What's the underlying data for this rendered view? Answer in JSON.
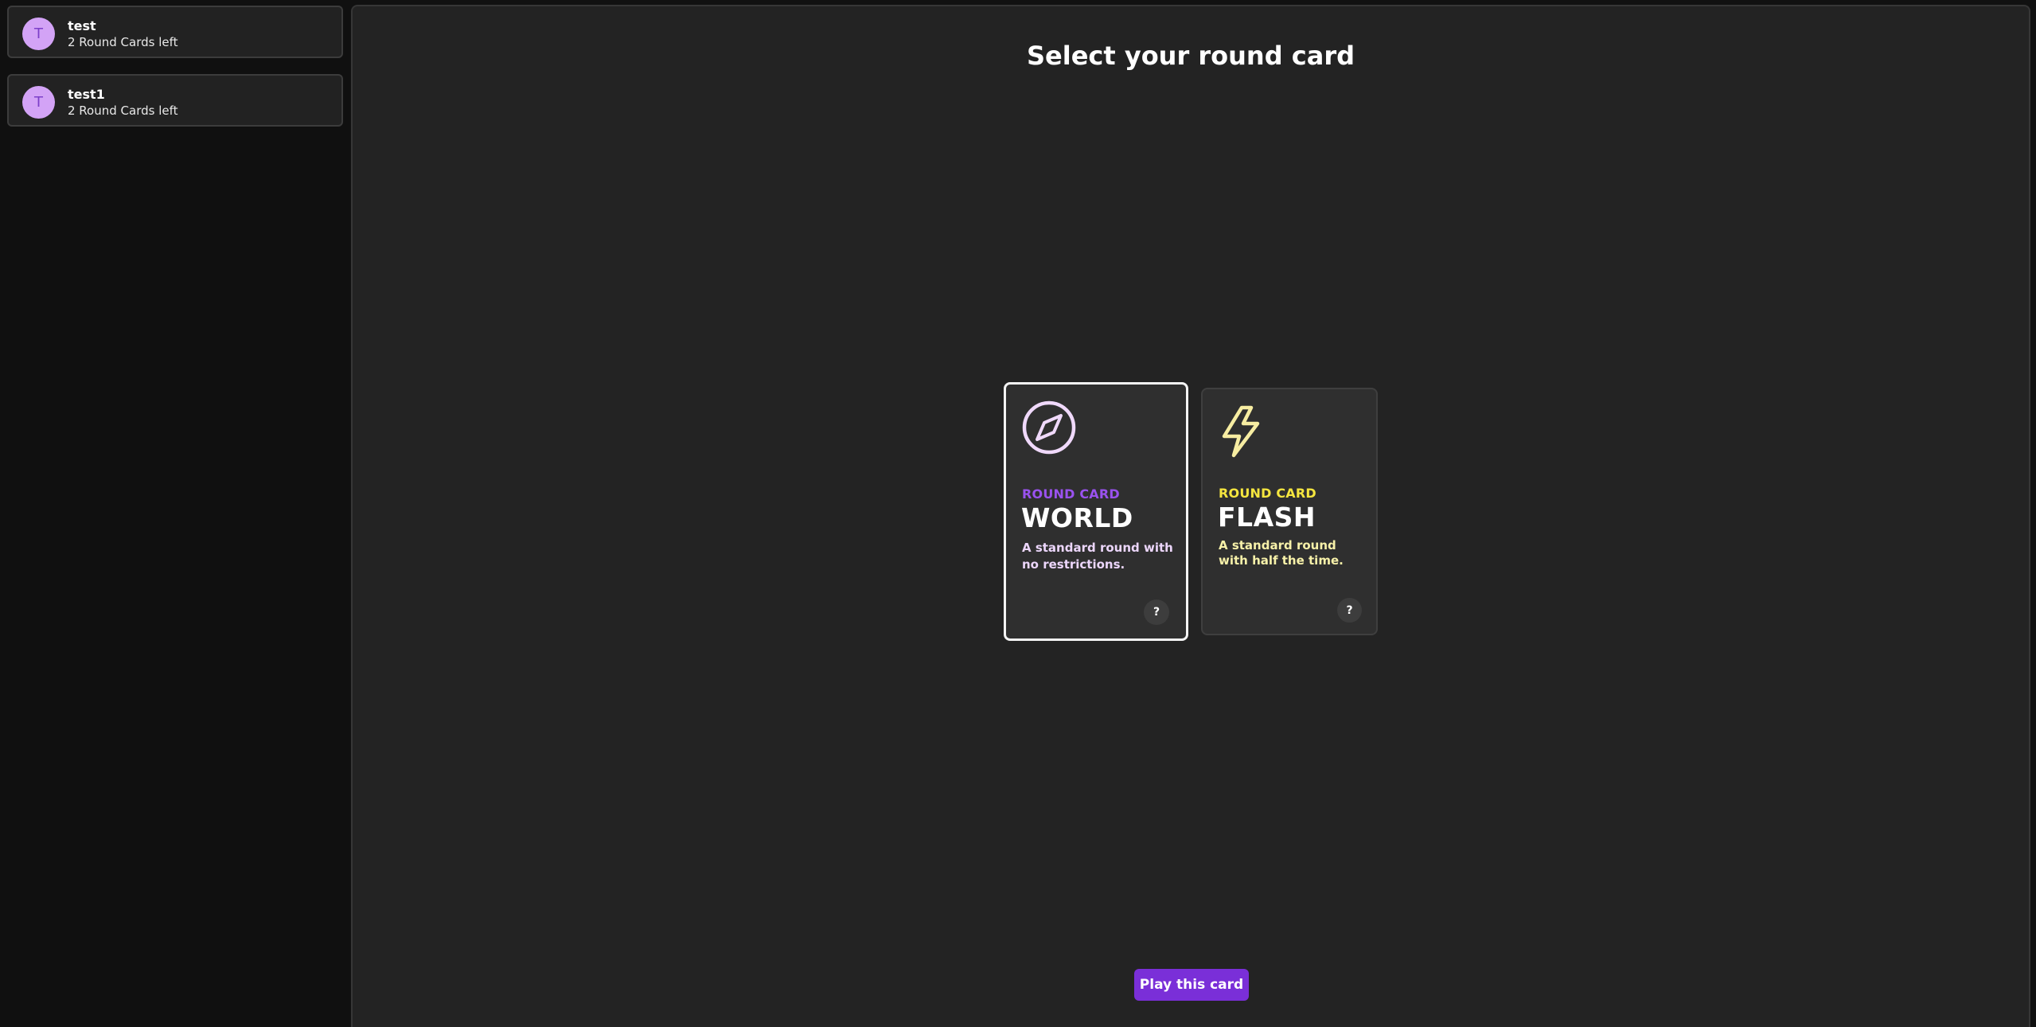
{
  "players": [
    {
      "initial": "T",
      "name": "test",
      "status": "2 Round Cards left"
    },
    {
      "initial": "T",
      "name": "test1",
      "status": "2 Round Cards left"
    }
  ],
  "main": {
    "title": "Select your round card",
    "play_button_label": "Play this card"
  },
  "cards": [
    {
      "kicker": "ROUND CARD",
      "title": "WORLD",
      "description": "A standard round with no restrictions.",
      "help_label": "?",
      "icon": "compass-icon",
      "accent_color": "#9a52ef",
      "selected": true
    },
    {
      "kicker": "ROUND CARD",
      "title": "FLASH",
      "description": "A standard round with half the time.",
      "help_label": "?",
      "icon": "lightning-icon",
      "accent_color": "#f5e63f",
      "selected": false
    }
  ],
  "colors": {
    "primary_button": "#7a2fd8",
    "avatar_bg": "#d3a3f6"
  }
}
